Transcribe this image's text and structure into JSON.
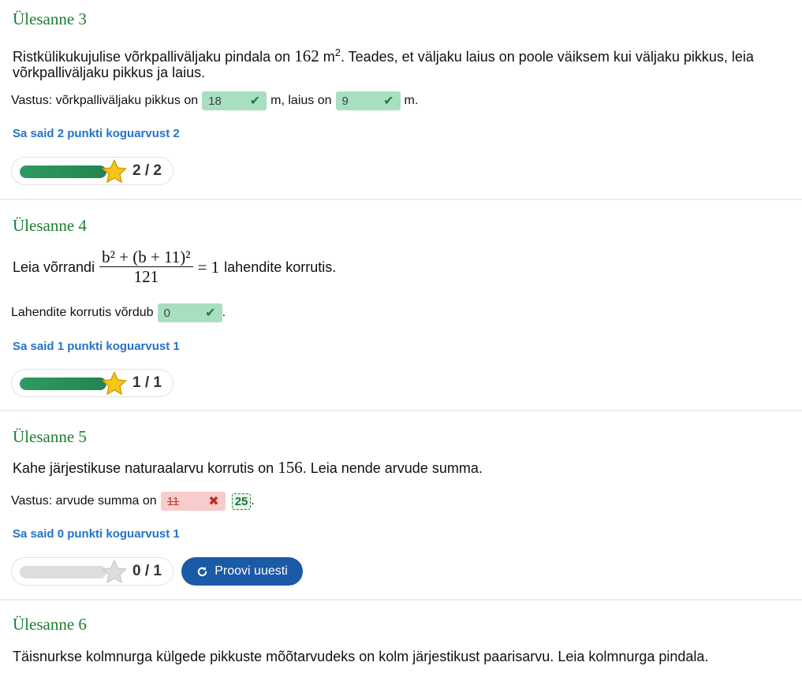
{
  "tasks": [
    {
      "title": "Ülesanne 3",
      "question_pre": "Ristkülikukujulise võrkpalliväljaku pindala on",
      "question_num": "162",
      "question_unit": "m",
      "question_sup": "2",
      "question_post": ". Teades, et väljaku laius on poole väiksem kui väljaku pikkus, leia",
      "question_line2": "võrkpalliväljaku pikkus ja laius.",
      "answer_prefix": "Vastus: võrkpalliväljaku pikkus on",
      "field1_value": "18",
      "answer_mid": "m, laius on",
      "field2_value": "9",
      "answer_suffix": "m.",
      "score_text": "Sa said 2 punkti koguarvust 2",
      "score": "2 / 2",
      "progress": 1.0
    },
    {
      "title": "Ülesanne 4",
      "question_pre": "Leia võrrandi",
      "numerator": "b² + (b + 11)²",
      "denominator": "121",
      "equals": "= 1",
      "question_post": "lahendite korrutis.",
      "answer_prefix": "Lahendite korrutis võrdub",
      "field1_value": "0",
      "answer_suffix": ".",
      "score_text": "Sa said 1 punkti koguarvust 1",
      "score": "1 / 1",
      "progress": 1.0
    },
    {
      "title": "Ülesanne 5",
      "question_pre": "Kahe järjestikuse naturaalarvu korrutis on",
      "question_num": "156",
      "question_post": ". Leia nende arvude summa.",
      "answer_prefix": "Vastus: arvude summa on",
      "field1_value": "11",
      "correct_hint": "25",
      "answer_suffix": ".",
      "score_text": "Sa said 0 punkti koguarvust 1",
      "score": "0 / 1",
      "progress": 0.0,
      "retry_label": "Proovi uuesti"
    },
    {
      "title": "Ülesanne 6",
      "question_pre": "Täisnurkse kolmnurga külgede pikkuste mõõtarvudeks on kolm järjestikust paarisarvu. Leia kolmnurga pindala."
    }
  ],
  "colors": {
    "title_green": "#1e7d32",
    "score_blue": "#2373c8",
    "correct_bg": "#a8dfc0",
    "wrong_bg": "#f6cccc",
    "bar_green": "#2f9a63",
    "retry_bg": "#1b5aa6",
    "star_gold": "#f5c518"
  },
  "icons": [
    "check-icon",
    "cross-icon",
    "star-icon",
    "refresh-icon"
  ]
}
